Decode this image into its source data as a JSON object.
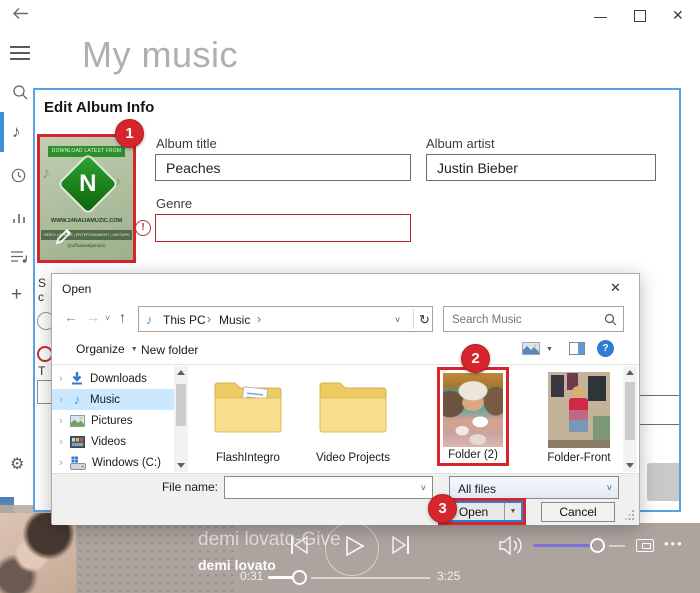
{
  "glyphs": {
    "back_arrow": "←",
    "forward_arrow": "→",
    "up_arrow": "↑",
    "chevron_down": "˅",
    "caret_down": "▼",
    "refresh": "↻",
    "breadcrumb_sep": "›",
    "nav_expand": "›",
    "music_note": "♪",
    "plus": "+",
    "gear": "⚙",
    "close_x": "✕",
    "more_dots": "•••",
    "error_mark": "!",
    "question": "?"
  },
  "window": {
    "page_title": "My music"
  },
  "edit_dialog": {
    "title": "Edit Album Info",
    "album_art": {
      "banner": "DOWNLOAD LATEST FROM",
      "logo_letter": "N",
      "website": "WWW.24NAIJAMUZIC.COM",
      "categories": "VIDEO | ALBUM | ENTERTAINMENT | MIXTAPE",
      "social": "@officialnaijamuzic"
    },
    "fields": {
      "album_title": {
        "label": "Album title",
        "value": "Peaches"
      },
      "album_artist": {
        "label": "Album artist",
        "value": "Justin Bieber"
      },
      "genre": {
        "label": "Genre",
        "value": ""
      }
    },
    "fragments": {
      "line1": "S",
      "line2": "c",
      "line3": "T"
    }
  },
  "annotations": {
    "step1": "1",
    "step2": "2",
    "step3": "3"
  },
  "open_dialog": {
    "title": "Open",
    "breadcrumb": [
      "This PC",
      "Music"
    ],
    "search_placeholder": "Search Music",
    "toolbar": {
      "organize": "Organize",
      "new_folder": "New folder"
    },
    "nav_items": [
      {
        "label": "Downloads"
      },
      {
        "label": "Music"
      },
      {
        "label": "Pictures"
      },
      {
        "label": "Videos"
      },
      {
        "label": "Windows (C:)"
      }
    ],
    "files": [
      {
        "name": "FlashIntegro"
      },
      {
        "name": "Video Projects"
      },
      {
        "name": "Folder (2)"
      },
      {
        "name": "Folder-Front"
      }
    ],
    "footer": {
      "file_name_label": "File name:",
      "file_type_value": "All files",
      "open_label": "Open",
      "cancel_label": "Cancel"
    }
  },
  "player": {
    "track_title": "demi lovato-Give",
    "artist": "demi lovato",
    "elapsed": "0:31",
    "duration": "3:25"
  },
  "colors": {
    "accent_blue": "#5ba2e0",
    "annotation_red": "#d6252c",
    "selection_blue": "#cce8ff",
    "player_bar": "#ada49f",
    "volume_purple": "#7e72da"
  }
}
